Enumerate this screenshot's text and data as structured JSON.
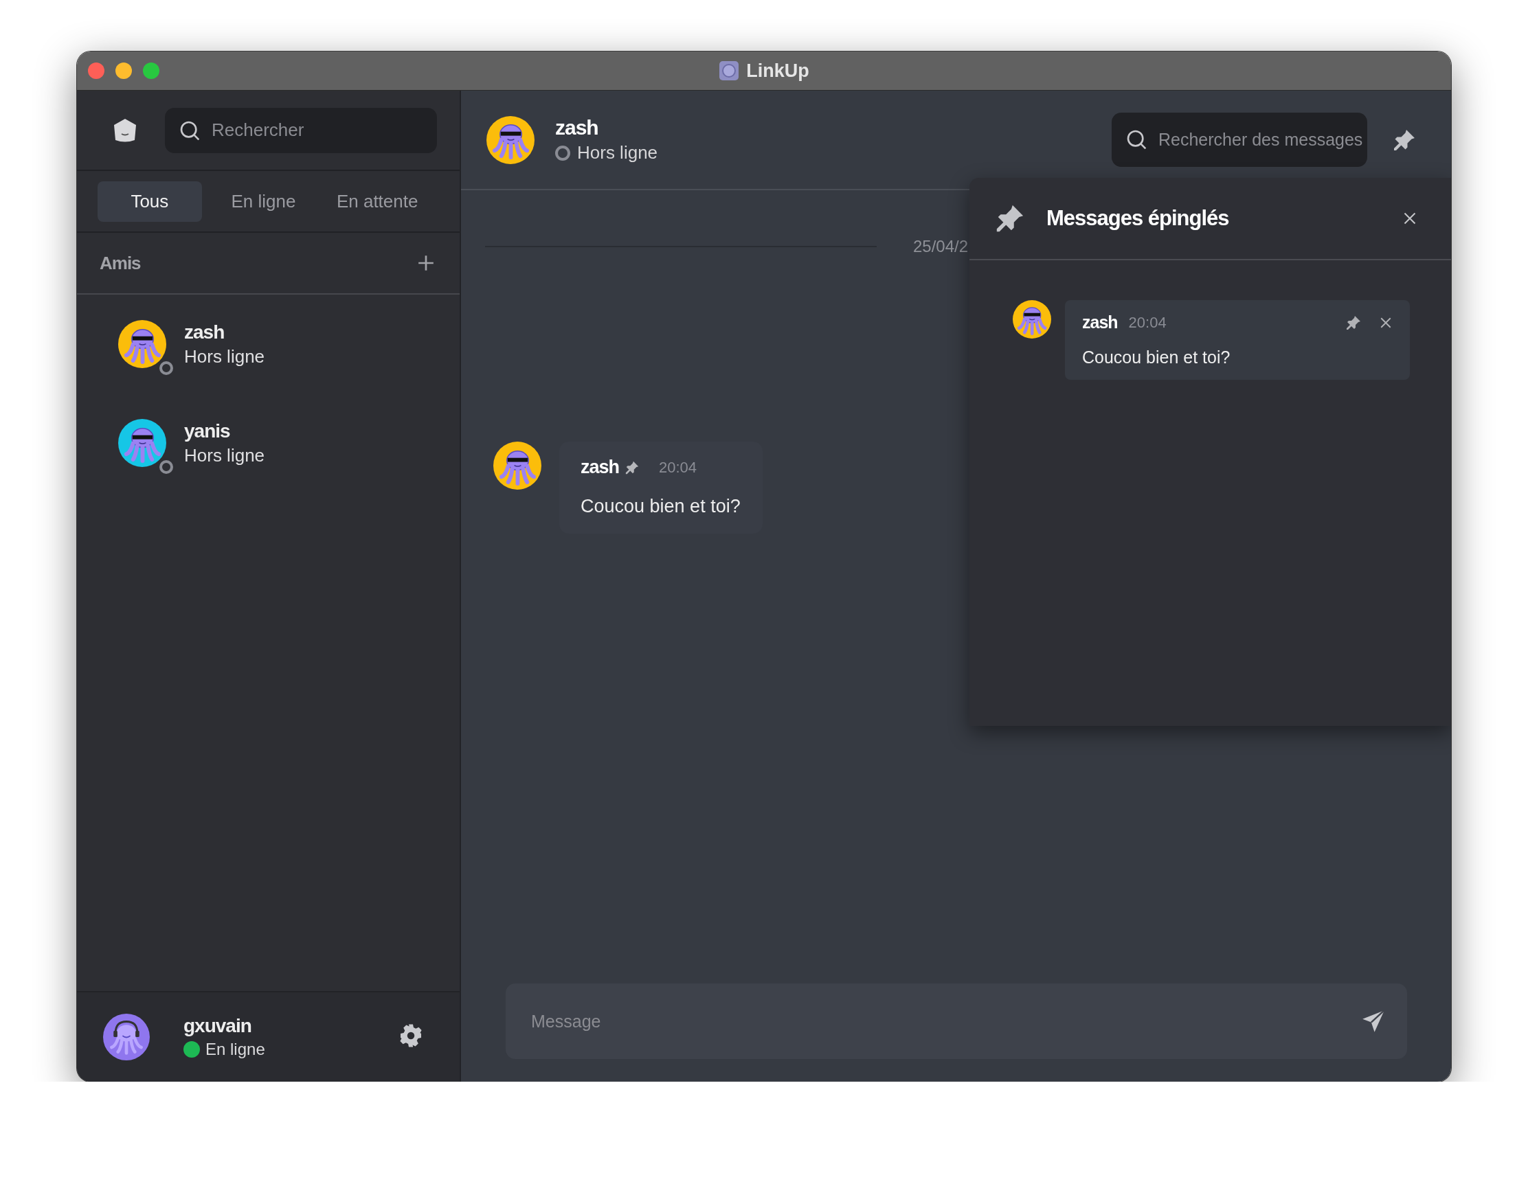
{
  "window": {
    "title": "LinkUp"
  },
  "sidebar": {
    "search": {
      "placeholder": "Rechercher"
    },
    "tabs": [
      {
        "label": "Tous",
        "selected": true
      },
      {
        "label": "En ligne",
        "selected": false
      },
      {
        "label": "En attente",
        "selected": false
      }
    ],
    "section": {
      "title": "Amis"
    },
    "friends": [
      {
        "name": "zash",
        "status": "Hors ligne",
        "online": false,
        "color": "#fbbd0b"
      },
      {
        "name": "yanis",
        "status": "Hors ligne",
        "online": false,
        "color": "#16c6e6"
      }
    ]
  },
  "user": {
    "name": "gxuvain",
    "status": "En ligne",
    "online": true
  },
  "chat": {
    "contact": {
      "name": "zash",
      "status": "Hors ligne",
      "online": false
    },
    "search": {
      "placeholder": "Rechercher des messages"
    },
    "date": "25/04/2",
    "messages": [
      {
        "author": "zash",
        "time": "20:04",
        "text": "Coucou bien et toi?",
        "pinned": true
      }
    ],
    "composer": {
      "placeholder": "Message"
    }
  },
  "pinned_panel": {
    "title": "Messages épinglés",
    "items": [
      {
        "author": "zash",
        "time": "20:04",
        "text": "Coucou bien et toi?"
      }
    ]
  }
}
